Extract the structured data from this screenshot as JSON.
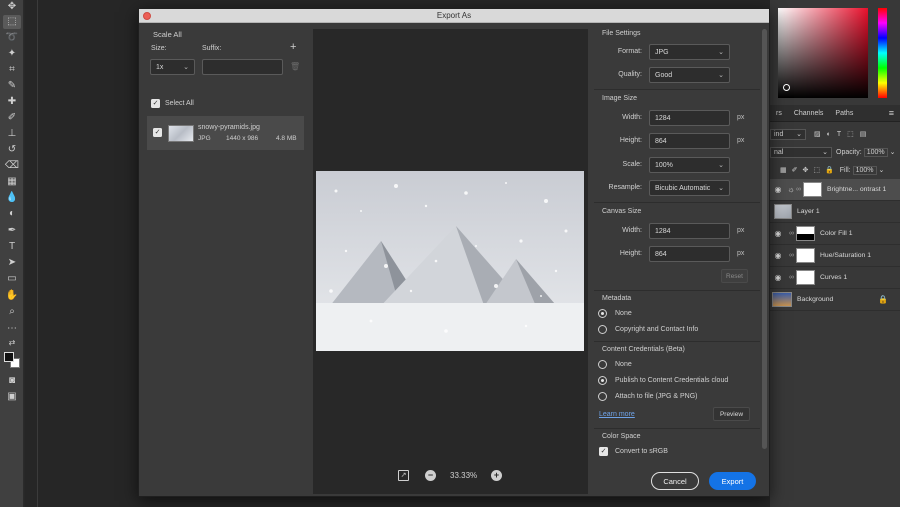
{
  "dialog": {
    "title": "Export As",
    "scale_all": {
      "heading": "Scale All",
      "size_label": "Size:",
      "suffix_label": "Suffix:",
      "add_symbol": "+",
      "size_value": "1x",
      "suffix_value": "",
      "select_all_label": "Select All"
    },
    "file": {
      "name": "snowy-pyramids.jpg",
      "format": "JPG",
      "dimensions": "1440 x 986",
      "size": "4.8 MB"
    },
    "zoom": {
      "value": "33.33%",
      "minus": "−",
      "plus": "+"
    },
    "file_settings": {
      "heading": "File Settings",
      "format_label": "Format:",
      "format_value": "JPG",
      "quality_label": "Quality:",
      "quality_value": "Good"
    },
    "image_size": {
      "heading": "Image Size",
      "width_label": "Width:",
      "width_value": "1284",
      "height_label": "Height:",
      "height_value": "864",
      "scale_label": "Scale:",
      "scale_value": "100%",
      "resample_label": "Resample:",
      "resample_value": "Bicubic Automatic",
      "unit": "px"
    },
    "canvas_size": {
      "heading": "Canvas Size",
      "width_label": "Width:",
      "width_value": "1284",
      "height_label": "Height:",
      "height_value": "864",
      "unit": "px",
      "reset_label": "Reset"
    },
    "metadata": {
      "heading": "Metadata",
      "options": [
        "None",
        "Copyright and Contact Info"
      ],
      "selected": 0
    },
    "content_credentials": {
      "heading": "Content Credentials (Beta)",
      "options": [
        "None",
        "Publish to Content Credentials cloud",
        "Attach to file (JPG & PNG)"
      ],
      "selected": 1,
      "learn_more": "Learn more",
      "preview_label": "Preview"
    },
    "color_space": {
      "heading": "Color Space",
      "convert_label": "Convert to sRGB"
    },
    "cancel_label": "Cancel",
    "export_label": "Export"
  },
  "layers_panel": {
    "tabs": [
      "rs",
      "Channels",
      "Paths"
    ],
    "blend_kind": "ind",
    "blend_mode": "nal",
    "opacity_label": "Opacity:",
    "opacity_value": "100%",
    "fill_label": "Fill:",
    "fill_value": "100%",
    "layers": [
      {
        "name": "Brightne... ontrast 1"
      },
      {
        "name": "Layer 1"
      },
      {
        "name": "Color Fill 1"
      },
      {
        "name": "Hue/Saturation 1"
      },
      {
        "name": "Curves 1"
      },
      {
        "name": "Background"
      }
    ]
  },
  "colors": {
    "accent": "#1473e6",
    "link": "#6fa3e8",
    "close_button": "#ec5f56"
  }
}
